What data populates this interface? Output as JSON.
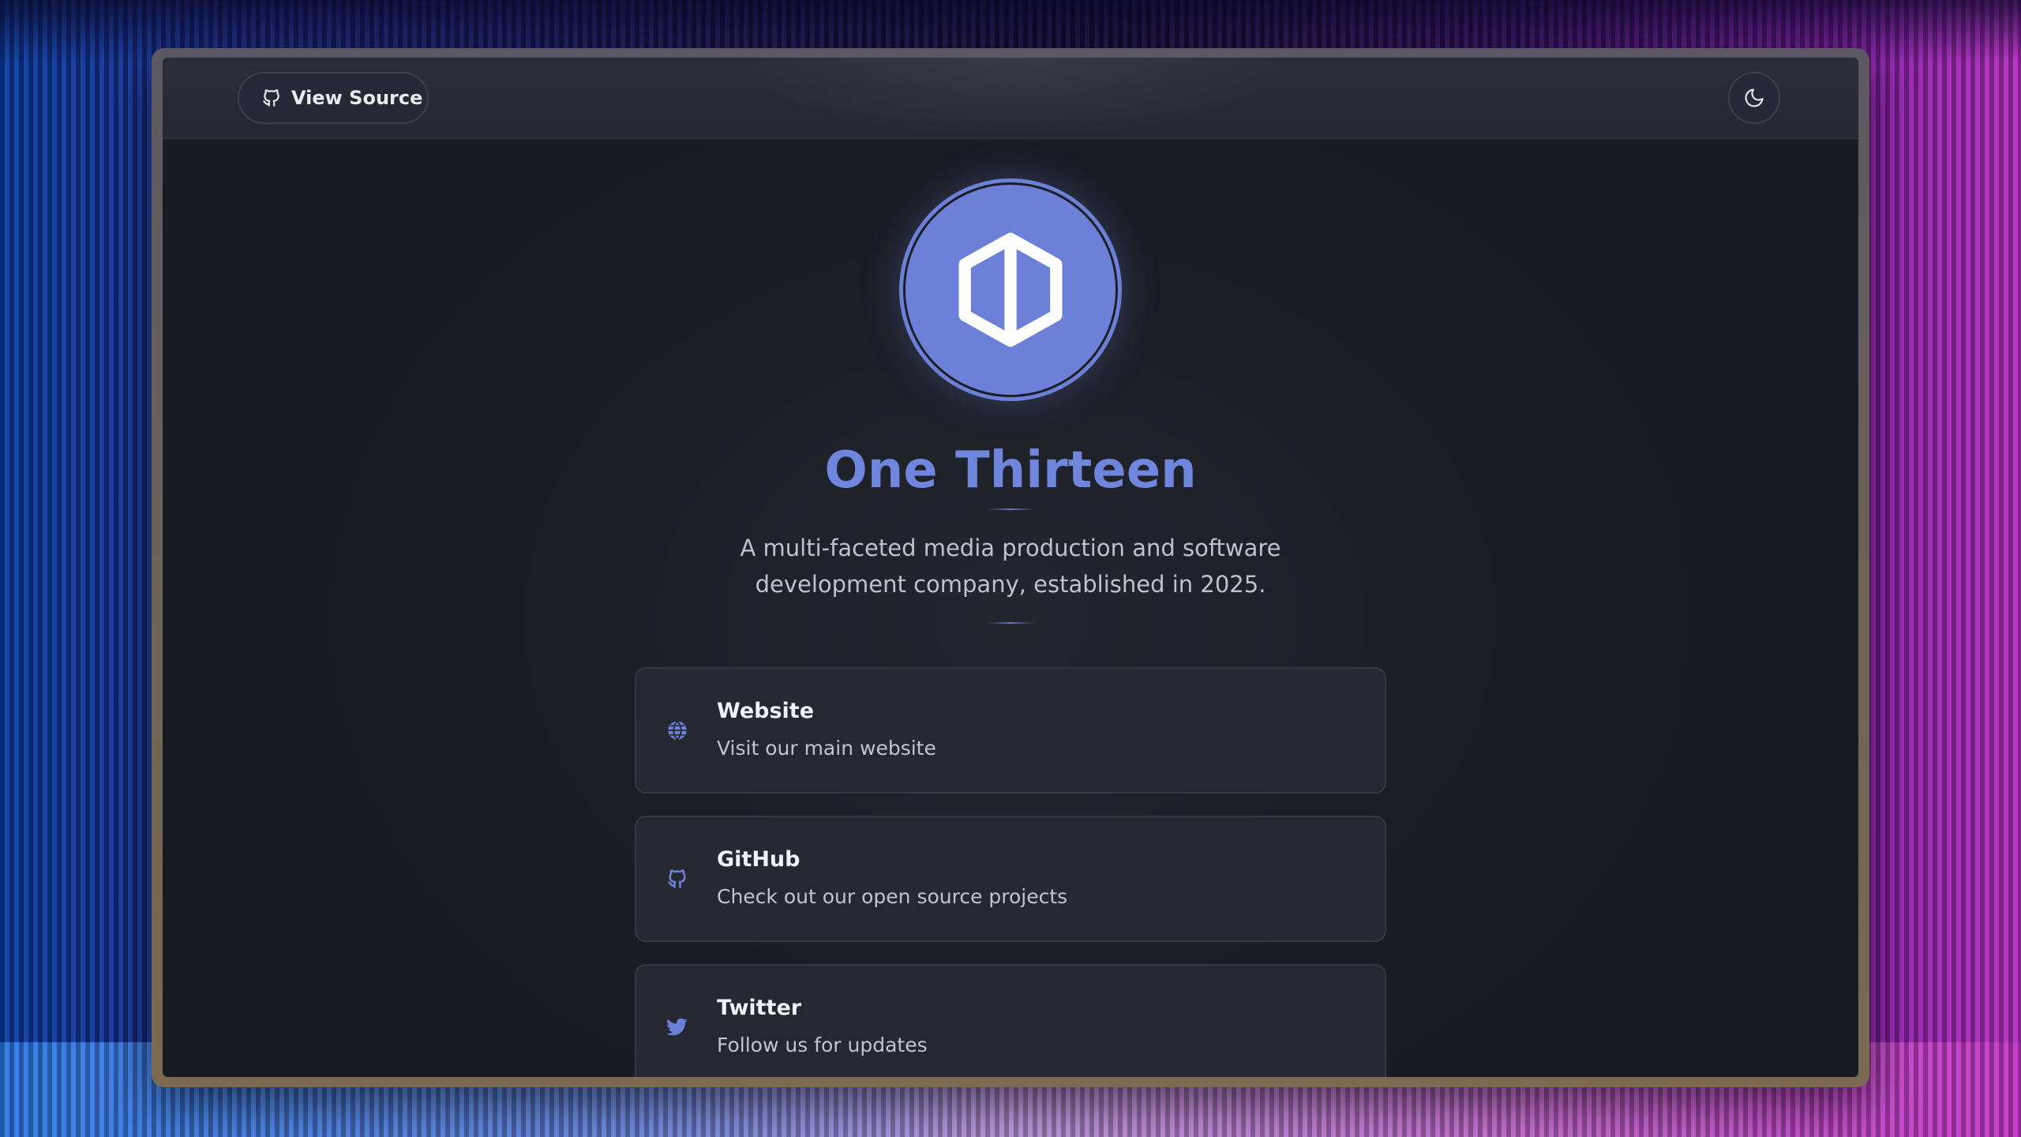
{
  "topbar": {
    "view_source_label": "View Source"
  },
  "hero": {
    "title": "One Thirteen",
    "subtitle_line1": "A multi-faceted media production and software",
    "subtitle_line2": "development company, established in 2025."
  },
  "links": [
    {
      "title": "Website",
      "description": "Visit our main website",
      "icon": "globe-icon"
    },
    {
      "title": "GitHub",
      "description": "Check out our open source projects",
      "icon": "github-icon"
    },
    {
      "title": "Twitter",
      "description": "Follow us for updates",
      "icon": "twitter-icon"
    }
  ],
  "colors": {
    "accent": "#7085dc",
    "background": "#1c1e26",
    "card": "#252731"
  }
}
